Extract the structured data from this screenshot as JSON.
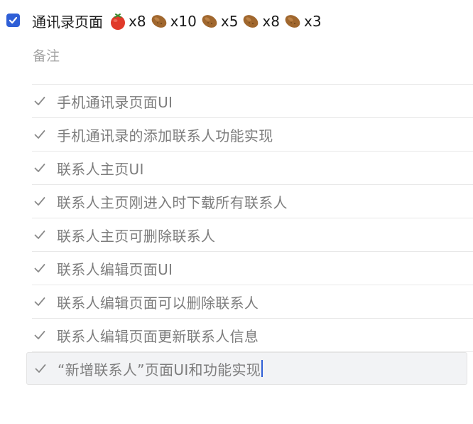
{
  "task": {
    "checked": true,
    "title": "通讯录页面",
    "pomodoros": [
      {
        "icon": "tomato-icon",
        "count": "x8"
      },
      {
        "icon": "potato-icon",
        "count": "x10"
      },
      {
        "icon": "potato-icon",
        "count": "x5"
      },
      {
        "icon": "potato-icon",
        "count": "x8"
      },
      {
        "icon": "potato-icon",
        "count": "x3"
      }
    ],
    "note_placeholder": "备注"
  },
  "subtasks": [
    {
      "label": "手机通讯录页面UI"
    },
    {
      "label": "手机通讯录的添加联系人功能实现"
    },
    {
      "label": "联系人主页UI"
    },
    {
      "label": "联系人主页刚进入时下载所有联系人"
    },
    {
      "label": "联系人主页可删除联系人"
    },
    {
      "label": "联系人编辑页面UI"
    },
    {
      "label": "联系人编辑页面可以删除联系人"
    },
    {
      "label": "联系人编辑页面更新联系人信息"
    },
    {
      "label": "“新增联系人”页面UI和功能实现"
    }
  ],
  "colors": {
    "accent": "#2f5fd6",
    "tomato": "#e03a2a",
    "potato": "#a0672e"
  }
}
